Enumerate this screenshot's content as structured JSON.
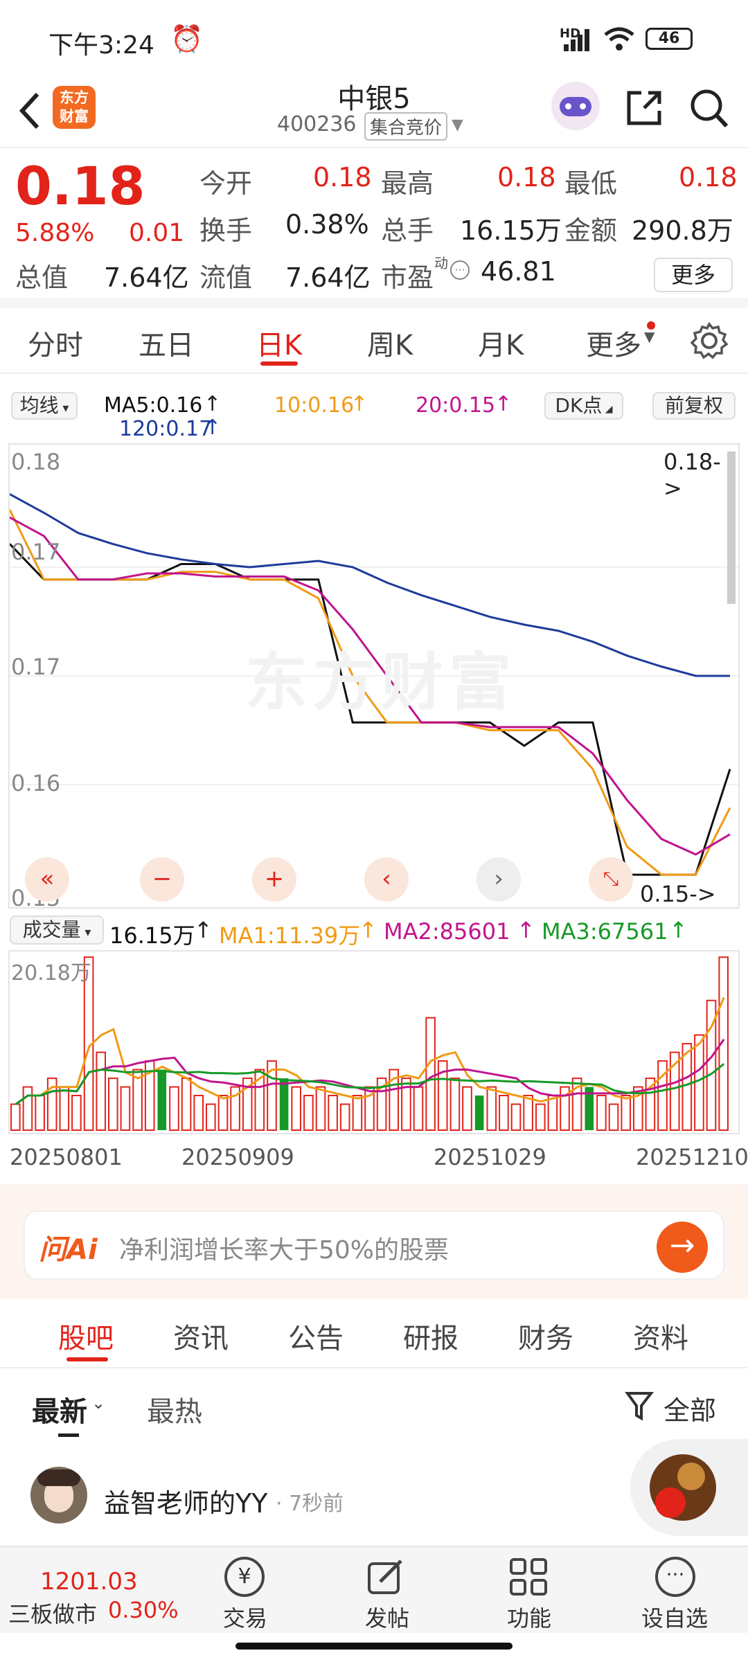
{
  "status_bar": {
    "time": "下午3:24",
    "battery": "46",
    "network": "HD"
  },
  "header": {
    "stock_name": "中银5",
    "stock_code": "400236",
    "market_tag": "集合竞价",
    "logo_text_top": "东方",
    "logo_text_bottom": "财富"
  },
  "quote": {
    "price": "0.18",
    "change_pct": "5.88%",
    "change_amt": "0.01",
    "open_label": "今开",
    "open": "0.18",
    "high_label": "最高",
    "high": "0.18",
    "low_label": "最低",
    "low": "0.18",
    "turnover_label": "换手",
    "turnover": "0.38%",
    "volume_label": "总手",
    "volume": "16.15万",
    "amount_label": "金额",
    "amount": "290.8万",
    "mktcap_label": "总值",
    "mktcap": "7.64亿",
    "float_label": "流值",
    "float": "7.64亿",
    "pe_label": "市盈",
    "pe_sup": "动",
    "pe": "46.81",
    "more_label": "更多"
  },
  "chart_tabs": [
    "分时",
    "五日",
    "日K",
    "周K",
    "月K",
    "更多"
  ],
  "active_chart_tab": "日K",
  "ma_bar": {
    "selector": "均线",
    "ma5": "MA5:0.16",
    "ma10": "10:0.16",
    "ma20": "20:0.15",
    "ma120": "120:0.17",
    "dk": "DK点",
    "adjust": "前复权"
  },
  "kline": {
    "y_labels": [
      "0.18",
      "0.17",
      "0.17",
      "0.16",
      "0.15"
    ],
    "top_marker": "0.18->",
    "bottom_marker": "0.15->",
    "watermark": "东方财富"
  },
  "volume_bar": {
    "selector": "成交量",
    "vol": "16.15万",
    "ma1": "MA1:11.39万",
    "ma2": "MA2:85601",
    "ma3": "MA3:67561",
    "max_label": "20.18万"
  },
  "dates": [
    "20250801",
    "20250909",
    "20251029",
    "20251210"
  ],
  "ask_ai": {
    "brand": "问Ai",
    "placeholder": "净利润增长率大于50%的股票"
  },
  "news_tabs": [
    "股吧",
    "资讯",
    "公告",
    "研报",
    "财务",
    "资料"
  ],
  "active_news_tab": "股吧",
  "sort_tabs": {
    "latest": "最新",
    "hot": "最热",
    "filter": "全部"
  },
  "post": {
    "user": "益智老师的YY",
    "time": "· 7秒前"
  },
  "bottom_nav": {
    "index_value": "1201.03",
    "index_name": "三板做市",
    "index_change": "0.30%",
    "trade": "交易",
    "post": "发帖",
    "func": "功能",
    "watch": "设自选"
  },
  "colors": {
    "up": "#e2231a",
    "down": "#159a27",
    "ma5": "#111111",
    "ma10": "#f09a16",
    "ma20": "#c0148c",
    "ma120": "#1d3b9b"
  },
  "chart_data": {
    "type": "line",
    "title": "",
    "series": [
      {
        "name": "MA5",
        "values": [
          0.1735,
          0.1712,
          0.1712,
          0.1712,
          0.1712,
          0.1722,
          0.1722,
          0.1712,
          0.1712,
          0.1712,
          0.162,
          0.162,
          0.162,
          0.162,
          0.162,
          0.1605,
          0.162,
          0.162,
          0.1522,
          0.1522,
          0.1522,
          0.159
        ]
      },
      {
        "name": "MA10",
        "values": [
          0.1757,
          0.1712,
          0.1712,
          0.1712,
          0.1712,
          0.1717,
          0.1717,
          0.1712,
          0.1712,
          0.17,
          0.165,
          0.162,
          0.162,
          0.162,
          0.1615,
          0.1615,
          0.1615,
          0.159,
          0.154,
          0.1522,
          0.1522,
          0.1565
        ]
      },
      {
        "name": "MA20",
        "values": [
          0.1752,
          0.174,
          0.1712,
          0.1712,
          0.1716,
          0.1716,
          0.1714,
          0.1714,
          0.1714,
          0.1705,
          0.168,
          0.165,
          0.162,
          0.162,
          0.1617,
          0.1617,
          0.1617,
          0.16,
          0.157,
          0.1545,
          0.1535,
          0.1548
        ]
      },
      {
        "name": "MA120",
        "values": [
          0.1767,
          0.1755,
          0.1742,
          0.1735,
          0.1729,
          0.1725,
          0.1722,
          0.172,
          0.1722,
          0.1724,
          0.172,
          0.171,
          0.1702,
          0.1695,
          0.1688,
          0.1683,
          0.1679,
          0.1672,
          0.1663,
          0.1656,
          0.165,
          0.165
        ]
      }
    ],
    "volume": [
      3,
      5,
      4,
      6,
      5,
      4,
      20,
      9,
      6,
      5,
      7,
      8,
      7,
      5,
      6,
      4,
      3,
      4,
      5,
      6,
      7,
      8,
      6,
      5,
      4,
      5,
      4,
      3,
      4,
      5,
      6,
      7,
      6,
      5,
      13,
      8,
      6,
      5,
      4,
      5,
      4,
      3,
      4,
      3,
      4,
      5,
      6,
      5,
      4,
      3,
      4,
      5,
      6,
      8,
      9,
      10,
      11,
      15,
      20
    ]
  }
}
